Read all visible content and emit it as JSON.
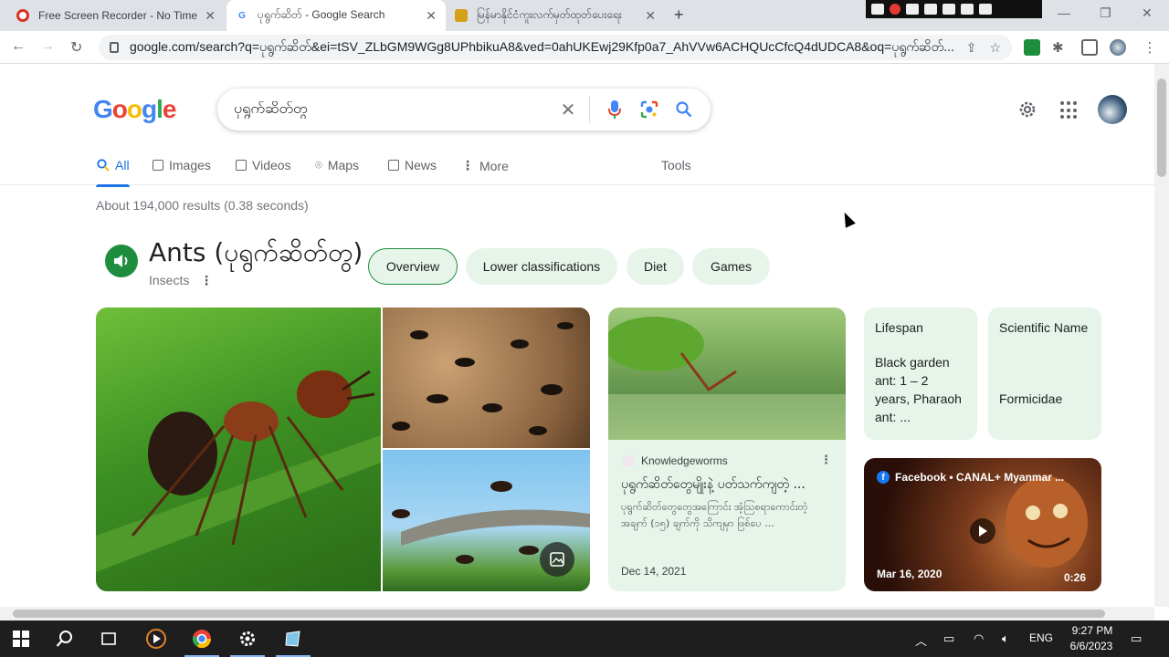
{
  "browser": {
    "tabs": [
      {
        "title": "Free Screen Recorder - No Time L",
        "favicon": "record-icon"
      },
      {
        "title": "ပုရွက်ဆိတ် - Google Search",
        "favicon": "google-g-icon"
      },
      {
        "title": "မြန်မာနိုင်ငံကူးလက်မှတ်ထုတ်ပေးရေး",
        "favicon": "myanmar-emblem-icon"
      }
    ],
    "new_tab": "+",
    "url": "google.com/search?q=ပုရွက်ဆိတ်&ei=tSV_ZLbGM9WGg8UPhbikuA8&ved=0ahUKEwj29Kfp0a7_AhVVw6ACHQUcCfcQ4dUDCA8&oq=ပုရွက်ဆိတ်..."
  },
  "google": {
    "logo_letters": [
      "G",
      "o",
      "o",
      "g",
      "l",
      "e"
    ],
    "logo_colors": [
      "#4285F4",
      "#EA4335",
      "#FBBC05",
      "#4285F4",
      "#34A853",
      "#EA4335"
    ],
    "query": "ပုရွက်ဆိတ်တွ",
    "tabs": [
      {
        "label": "All",
        "icon": "search-icon"
      },
      {
        "label": "Images",
        "icon": "image-icon"
      },
      {
        "label": "Videos",
        "icon": "video-icon"
      },
      {
        "label": "Maps",
        "icon": "map-pin-icon"
      },
      {
        "label": "News",
        "icon": "news-icon"
      },
      {
        "label": "More",
        "icon": "more-vert-icon"
      }
    ],
    "tools_label": "Tools",
    "results_count": "About 194,000 results (0.38 seconds)"
  },
  "knowledge_panel": {
    "title": "Ants (ပုရွက်ဆိတ်တွ)",
    "subtitle": "Insects",
    "chips": [
      "Overview",
      "Lower classifications",
      "Diet",
      "Games"
    ],
    "article": {
      "source": "Knowledgeworms",
      "title": "ပုရွက်ဆိတ်တွေမျိုးနဲ့ ပတ်သက်ကျတဲ့ ...",
      "snippet": "ပုရွက်ဆိတ်တွေတွေအကြောင်း အံ့သြစရာကောင်းတဲ့ အချက် (၁၅) ချက်ကို သိကျမှာ ဖြစ်ပေ ...",
      "date": "Dec 14, 2021"
    },
    "facts": [
      {
        "label": "Lifespan",
        "value": "Black garden ant: 1 – 2 years, Pharaoh ant: ..."
      },
      {
        "label": "Scientific Name",
        "value": "Formicidae"
      }
    ],
    "video": {
      "source": "Facebook • CANAL+ Myanmar ...",
      "date": "Mar 16, 2020",
      "duration": "0:26"
    }
  },
  "taskbar": {
    "lang": "ENG",
    "time": "9:27 PM",
    "date": "6/6/2023"
  },
  "colors": {
    "accent_blue": "#1a73e8",
    "chip_green_bg": "#e6f4ea",
    "audio_green": "#1e8e3e"
  }
}
